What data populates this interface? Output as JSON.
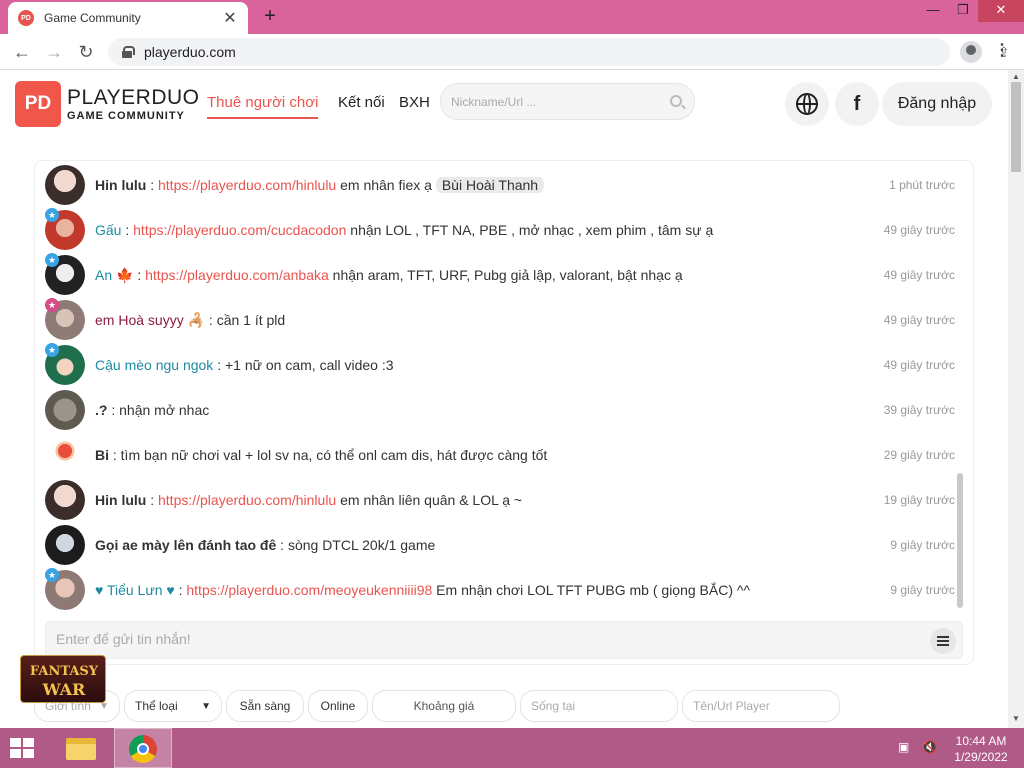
{
  "browser": {
    "tab_title": "Game Community",
    "tab_favicon": "PD",
    "tab_close": "✕",
    "new_tab": "+",
    "url": "playerduo.com",
    "window": {
      "minimize": "—",
      "maximize": "❐",
      "close": "✕"
    },
    "nav": {
      "back": "←",
      "forward": "→",
      "reload": "↻"
    },
    "share_icon": "⇪",
    "star_icon": "☆",
    "menu_icon": "⋮"
  },
  "site": {
    "logo": "PD",
    "brand": "PLAYERDUO",
    "brand_sub": "GAME COMMUNITY",
    "nav": {
      "hire": "Thuê người chơi",
      "connect": "Kết nối",
      "rank": "BXH"
    },
    "search_placeholder": "Nickname/Url ...",
    "facebook": "f",
    "login": "Đăng nhập"
  },
  "chat": {
    "messages": [
      {
        "name": "Hin lulu",
        "sep": " : ",
        "link": "https://playerduo.com/hinlulu",
        "text": " em nhân fiex ạ ",
        "tag": "Bùi Hoài Thanh",
        "time": "1 phút trước"
      },
      {
        "name": "Gấu",
        "sep": " : ",
        "link": "https://playerduo.com/cucdacodon",
        "text": " nhận LOL , TFT NA, PBE , mở nhạc , xem phim , tâm sự ạ",
        "time": "49 giây trước"
      },
      {
        "name": "An 🍁",
        "sep": " : ",
        "link": "https://playerduo.com/anbaka",
        "text": " nhận aram, TFT, URF, Pubg giả lập, valorant, bật nhạc ạ",
        "time": "49 giây trước"
      },
      {
        "name": "em Hoà suyyy 🦂",
        "sep": " : ",
        "text": " cần 1 ít pld",
        "time": "49 giây trước"
      },
      {
        "name": "Cậu mèo ngu ngok",
        "sep": " : ",
        "text": " +1 nữ on cam, call video :3",
        "time": "49 giây trước"
      },
      {
        "name": ".?",
        "sep": " : ",
        "text": " nhận mở nhac",
        "time": "39 giây trước"
      },
      {
        "name": "Bi",
        "sep": " : ",
        "text": " tìm bạn nữ chơi val + lol sv na, có thể onl cam dis, hát được càng tốt",
        "time": "29 giây trước"
      },
      {
        "name": "Hin lulu",
        "sep": " : ",
        "link": "https://playerduo.com/hinlulu",
        "text": " em nhân liên quân & LOL ạ ~",
        "time": "19 giây trước"
      },
      {
        "name": "Gọi ae mày lên đánh tao đê",
        "sep": " : ",
        "text": " sòng DTCL 20k/1 game",
        "time": "9 giây trước"
      },
      {
        "name": "♥ Tiểu Lưn ♥",
        "sep": " : ",
        "link": "https://playerduo.com/meoyeukenniiii98",
        "text": " Em nhận chơi LOL TFT PUBG mb ( giọng BẮC) ^^",
        "time": "9 giây trước"
      }
    ],
    "input_placeholder": "Enter để gửi tin nhắn!"
  },
  "filters": {
    "gender": "Giới tính",
    "genre": "Thể loại",
    "ready": "Sẵn sàng",
    "online": "Online",
    "price": "Khoảng giá",
    "live_placeholder": "Sống tại",
    "player_placeholder": "Tên/Url Player"
  },
  "ad": {
    "line1": "FANTASY",
    "line2": "WAR"
  },
  "taskbar": {
    "time": "10:44 AM",
    "date": "1/29/2022"
  },
  "colors": {
    "accent": "#e8544f",
    "tabstrip": "#d9649c",
    "taskbar": "#b05a87",
    "teal_name": "#1e8ba0"
  }
}
